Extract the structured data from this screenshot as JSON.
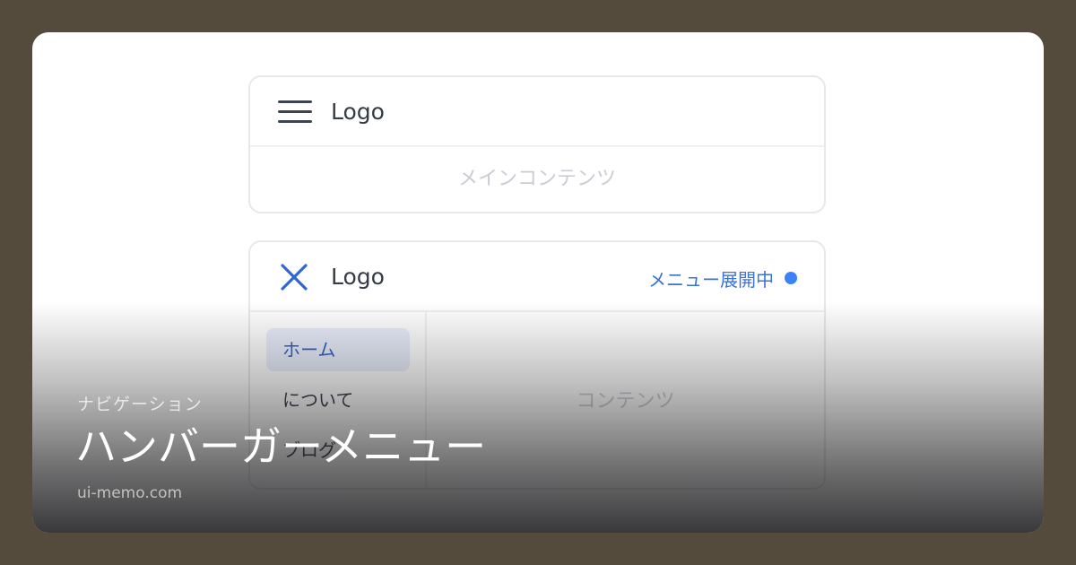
{
  "mock_closed": {
    "logo": "Logo",
    "main_content": "メインコンテンツ"
  },
  "mock_open": {
    "logo": "Logo",
    "status": "メニュー展開中",
    "menu_items": [
      {
        "label": "ホーム",
        "active": true
      },
      {
        "label": "について",
        "active": false
      },
      {
        "label": "ブログ",
        "active": false
      }
    ],
    "content": "コンテンツ"
  },
  "caption": {
    "category": "ナビゲーション",
    "title": "ハンバーガーメニュー",
    "site": "ui-memo.com"
  },
  "icons": {
    "menu": "hamburger-menu-icon",
    "close": "close-icon"
  },
  "colors": {
    "background": "#554b3c",
    "accent": "#3b82f6",
    "active_bg": "#e9eefb"
  }
}
